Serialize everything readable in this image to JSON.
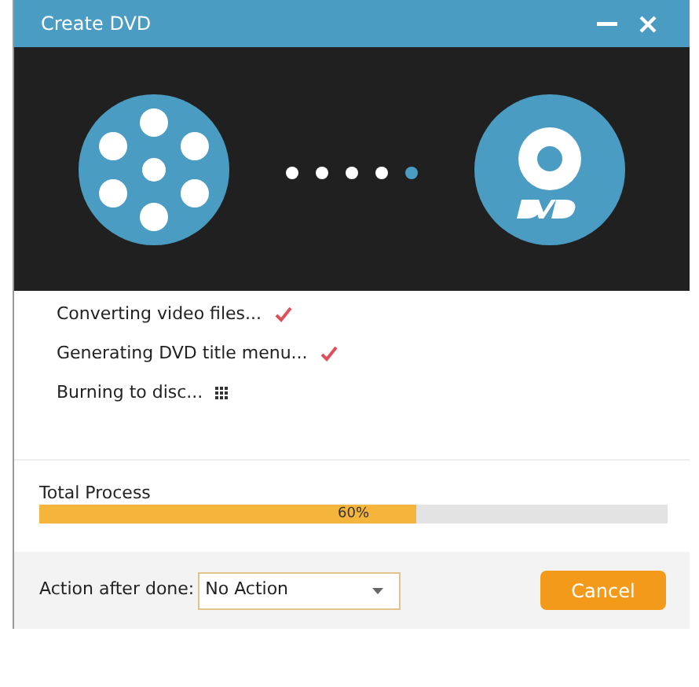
{
  "window": {
    "title": "Create DVD"
  },
  "progress_dots": [
    {
      "selected": false
    },
    {
      "selected": false
    },
    {
      "selected": false
    },
    {
      "selected": false
    },
    {
      "selected": true
    }
  ],
  "steps": [
    {
      "label": "Converting video files...",
      "done": true
    },
    {
      "label": "Generating DVD title menu...",
      "done": true
    },
    {
      "label": "Burning to disc...",
      "done": false
    }
  ],
  "total_process": {
    "label": "Total Process",
    "level": 0.6,
    "reading": "60%"
  },
  "footer": {
    "action_label": "Action after done:",
    "action_value": "No Action",
    "cancel_label": "Cancel"
  }
}
